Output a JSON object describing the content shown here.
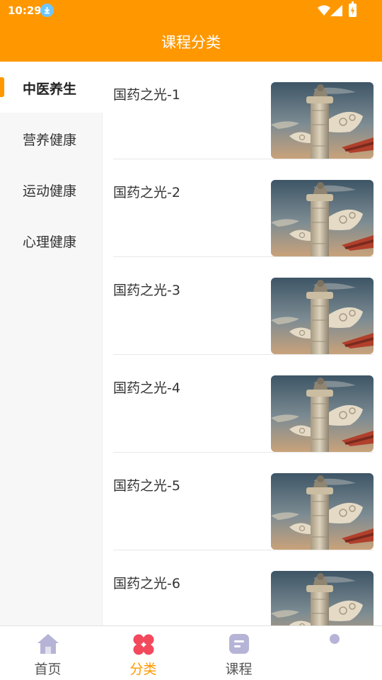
{
  "status_bar": {
    "time": "10:29"
  },
  "header": {
    "title": "课程分类"
  },
  "sidebar": {
    "items": [
      {
        "label": "中医养生",
        "active": true
      },
      {
        "label": "营养健康",
        "active": false
      },
      {
        "label": "运动健康",
        "active": false
      },
      {
        "label": "心理健康",
        "active": false
      }
    ]
  },
  "courses": [
    {
      "title": "国药之光-1"
    },
    {
      "title": "国药之光-2"
    },
    {
      "title": "国药之光-3"
    },
    {
      "title": "国药之光-4"
    },
    {
      "title": "国药之光-5"
    },
    {
      "title": "国药之光-6"
    }
  ],
  "tabbar": {
    "tabs": [
      {
        "label": "首页",
        "icon": "home-icon",
        "active": false
      },
      {
        "label": "分类",
        "icon": "category-icon",
        "active": true
      },
      {
        "label": "课程",
        "icon": "course-icon",
        "active": false
      },
      {
        "label": "",
        "icon": "profile-icon",
        "active": false
      }
    ]
  },
  "colors": {
    "accent": "#FF9800",
    "category_icon": "#F2495C",
    "inactive_icon": "#B6B4D6"
  }
}
